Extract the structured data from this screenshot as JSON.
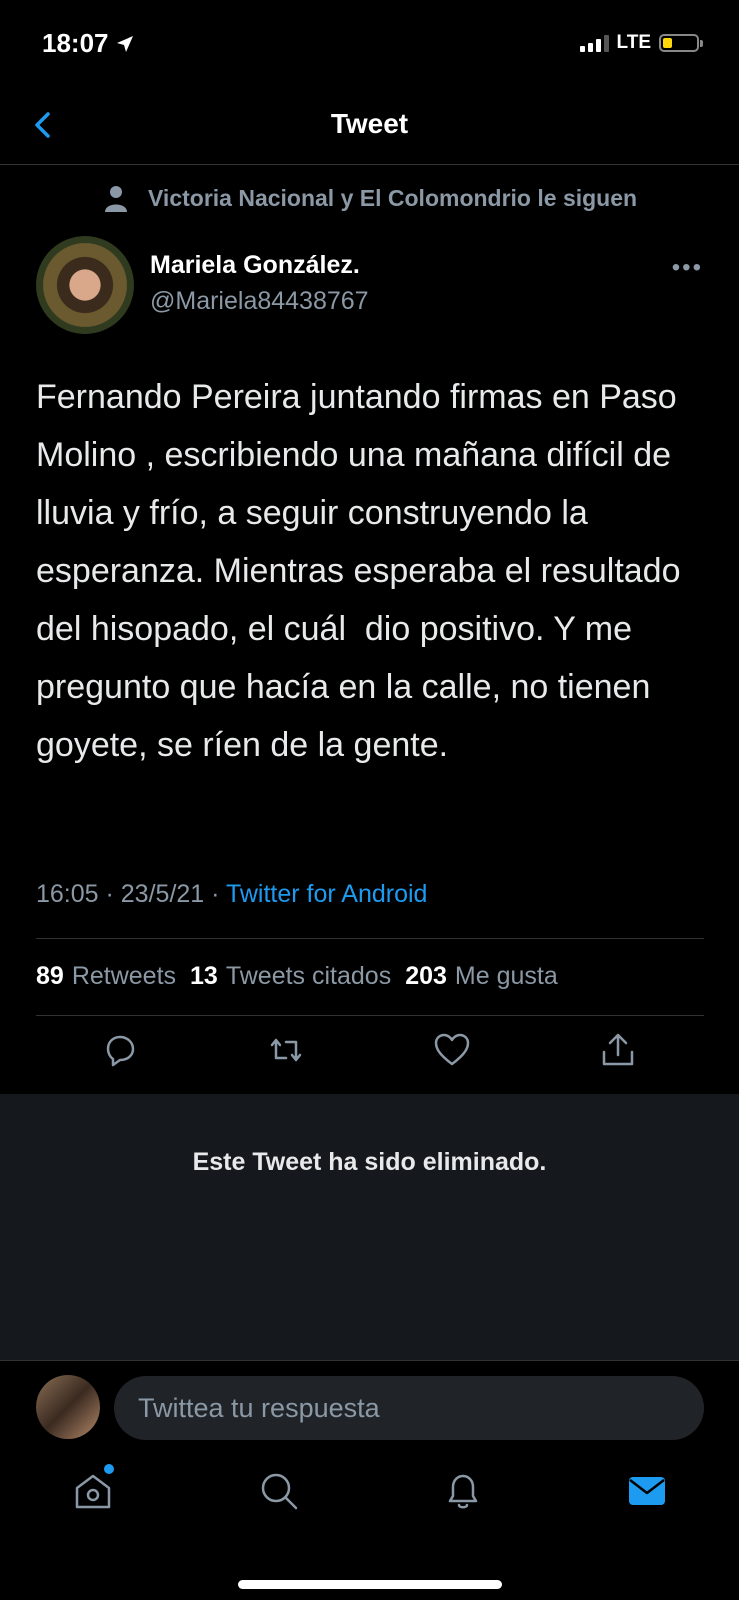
{
  "status_bar": {
    "time": "18:07",
    "network": "LTE"
  },
  "header": {
    "title": "Tweet"
  },
  "social_context": {
    "text": "Victoria Nacional y El Colomondrio le siguen"
  },
  "author": {
    "name": "Mariela González.",
    "handle": "@Mariela84438767"
  },
  "tweet": {
    "text": "Fernando Pereira juntando firmas en Paso Molino , escribiendo una mañana difícil de lluvia y frío, a seguir construyendo la esperanza. Mientras esperaba el resultado del hisopado, el cuál  dio positivo. Y me pregunto que hacía en la calle, no tienen goyete, se ríen de la gente.",
    "time": "16:05",
    "date": "23/5/21",
    "source": "Twitter for Android"
  },
  "stats": {
    "retweets_count": "89",
    "retweets_label": "Retweets",
    "quotes_count": "13",
    "quotes_label": "Tweets citados",
    "likes_count": "203",
    "likes_label": "Me gusta"
  },
  "deleted_notice": "Este Tweet ha sido eliminado.",
  "reply": {
    "placeholder": "Twittea tu respuesta"
  },
  "colors": {
    "accent": "#1d9bf0",
    "secondary_text": "#8b98a5",
    "background": "#000000"
  },
  "tabbar": {
    "items": [
      "home-icon",
      "search-icon",
      "notifications-icon",
      "messages-icon"
    ],
    "active": "messages-icon"
  }
}
